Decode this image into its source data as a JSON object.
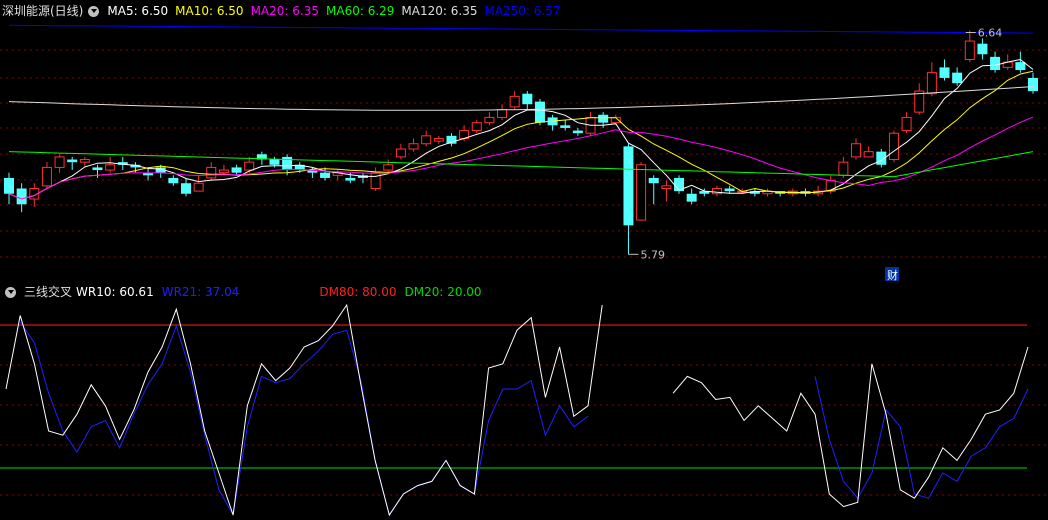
{
  "main_panel": {
    "stock_title": "深圳能源(日线)",
    "indicators": [
      {
        "label": "MA5: 6.50",
        "color": "#ffffff"
      },
      {
        "label": "MA10: 6.50",
        "color": "#ffff00"
      },
      {
        "label": "MA20: 6.35",
        "color": "#ff00ff"
      },
      {
        "label": "MA60: 6.29",
        "color": "#00ff00"
      },
      {
        "label": "MA120: 6.35",
        "color": "#dddddd"
      },
      {
        "label": "MA250: 6.57",
        "color": "#0000ff"
      }
    ],
    "high_label": "6.64",
    "low_label": "5.79",
    "finance_badge": "财"
  },
  "sub_panel": {
    "indicator_name": "三线交叉",
    "wr10_label": "WR10: 60.61",
    "wr21_label": "WR21: 37.04",
    "dm80_label": "DM80: 80.00",
    "dm20_label": "DM20: 20.00"
  },
  "colors": {
    "up": "#ff3030",
    "down": "#54ffff",
    "grid": "#8b0000",
    "border": "#b00000",
    "wr10": "#ffffff",
    "wr21": "#2020ff",
    "dm80": "#ff2020",
    "dm20": "#00dd00"
  },
  "chart_data": {
    "type": "candlestick",
    "price_range": [
      5.7,
      6.68
    ],
    "candles": [
      [
        6.08,
        6.02,
        6.1,
        5.98
      ],
      [
        6.04,
        5.98,
        6.06,
        5.95
      ],
      [
        6.0,
        6.04,
        6.06,
        5.97
      ],
      [
        6.05,
        6.12,
        6.14,
        6.04
      ],
      [
        6.12,
        6.16,
        6.17,
        6.1
      ],
      [
        6.15,
        6.14,
        6.16,
        6.11
      ],
      [
        6.14,
        6.15,
        6.16,
        6.12
      ],
      [
        6.12,
        6.11,
        6.13,
        6.08
      ],
      [
        6.11,
        6.13,
        6.16,
        6.1
      ],
      [
        6.14,
        6.13,
        6.16,
        6.11
      ],
      [
        6.13,
        6.12,
        6.14,
        6.1
      ],
      [
        6.1,
        6.09,
        6.12,
        6.07
      ],
      [
        6.12,
        6.1,
        6.13,
        6.08
      ],
      [
        6.08,
        6.06,
        6.09,
        6.05
      ],
      [
        6.06,
        6.02,
        6.08,
        6.01
      ],
      [
        6.03,
        6.06,
        6.09,
        6.03
      ],
      [
        6.08,
        6.12,
        6.14,
        6.07
      ],
      [
        6.1,
        6.11,
        6.13,
        6.09
      ],
      [
        6.12,
        6.1,
        6.13,
        6.09
      ],
      [
        6.11,
        6.14,
        6.16,
        6.1
      ],
      [
        6.17,
        6.15,
        6.18,
        6.13
      ],
      [
        6.15,
        6.13,
        6.16,
        6.12
      ],
      [
        6.16,
        6.11,
        6.17,
        6.09
      ],
      [
        6.13,
        6.11,
        6.14,
        6.1
      ],
      [
        6.11,
        6.1,
        6.12,
        6.08
      ],
      [
        6.1,
        6.08,
        6.12,
        6.07
      ],
      [
        6.09,
        6.1,
        6.11,
        6.07
      ],
      [
        6.08,
        6.07,
        6.1,
        6.06
      ],
      [
        6.09,
        6.08,
        6.1,
        6.06
      ],
      [
        6.04,
        6.1,
        6.12,
        6.03
      ],
      [
        6.11,
        6.13,
        6.15,
        6.1
      ],
      [
        6.16,
        6.19,
        6.21,
        6.15
      ],
      [
        6.19,
        6.21,
        6.23,
        6.18
      ],
      [
        6.21,
        6.24,
        6.26,
        6.2
      ],
      [
        6.22,
        6.23,
        6.24,
        6.21
      ],
      [
        6.24,
        6.21,
        6.25,
        6.2
      ],
      [
        6.23,
        6.26,
        6.28,
        6.22
      ],
      [
        6.26,
        6.29,
        6.3,
        6.25
      ],
      [
        6.29,
        6.31,
        6.33,
        6.28
      ],
      [
        6.31,
        6.34,
        6.36,
        6.3
      ],
      [
        6.35,
        6.39,
        6.41,
        6.34
      ],
      [
        6.4,
        6.36,
        6.41,
        6.34
      ],
      [
        6.37,
        6.29,
        6.38,
        6.28
      ],
      [
        6.31,
        6.28,
        6.32,
        6.26
      ],
      [
        6.28,
        6.27,
        6.3,
        6.26
      ],
      [
        6.26,
        6.25,
        6.27,
        6.24
      ],
      [
        6.25,
        6.31,
        6.33,
        6.24
      ],
      [
        6.32,
        6.29,
        6.33,
        6.27
      ],
      [
        6.29,
        6.31,
        6.32,
        6.28
      ],
      [
        6.2,
        5.9,
        6.21,
        5.79
      ],
      [
        5.92,
        6.13,
        6.14,
        5.92
      ],
      [
        6.08,
        6.06,
        6.09,
        5.98
      ],
      [
        6.04,
        6.05,
        6.07,
        5.99
      ],
      [
        6.08,
        6.03,
        6.09,
        6.02
      ],
      [
        6.02,
        5.99,
        6.04,
        5.98
      ],
      [
        6.03,
        6.02,
        6.04,
        6.01
      ],
      [
        6.02,
        6.04,
        6.05,
        6.01
      ],
      [
        6.04,
        6.03,
        6.05,
        6.02
      ],
      [
        6.03,
        6.03,
        6.04,
        6.02
      ],
      [
        6.03,
        6.02,
        6.04,
        6.01
      ],
      [
        6.02,
        6.03,
        6.04,
        6.01
      ],
      [
        6.03,
        6.02,
        6.03,
        6.01
      ],
      [
        6.02,
        6.03,
        6.04,
        6.01
      ],
      [
        6.03,
        6.02,
        6.04,
        6.01
      ],
      [
        6.02,
        6.03,
        6.05,
        6.01
      ],
      [
        6.03,
        6.07,
        6.09,
        6.02
      ],
      [
        6.09,
        6.14,
        6.16,
        6.08
      ],
      [
        6.16,
        6.21,
        6.23,
        6.15
      ],
      [
        6.16,
        6.18,
        6.2,
        6.16
      ],
      [
        6.18,
        6.13,
        6.19,
        6.12
      ],
      [
        6.15,
        6.25,
        6.26,
        6.14
      ],
      [
        6.26,
        6.31,
        6.33,
        6.25
      ],
      [
        6.33,
        6.41,
        6.44,
        6.32
      ],
      [
        6.4,
        6.48,
        6.52,
        6.39
      ],
      [
        6.5,
        6.46,
        6.53,
        6.45
      ],
      [
        6.48,
        6.44,
        6.5,
        6.43
      ],
      [
        6.53,
        6.6,
        6.64,
        6.52
      ],
      [
        6.59,
        6.55,
        6.61,
        6.53
      ],
      [
        6.54,
        6.49,
        6.56,
        6.48
      ],
      [
        6.5,
        6.52,
        6.55,
        6.49
      ],
      [
        6.52,
        6.49,
        6.56,
        6.48
      ],
      [
        6.46,
        6.41,
        6.48,
        6.4
      ]
    ],
    "wr10": [
      60,
      95,
      72,
      40,
      38,
      48,
      62,
      52,
      36,
      50,
      68,
      80,
      98,
      72,
      40,
      20,
      0,
      52,
      72,
      64,
      70,
      80,
      83,
      90,
      100,
      62,
      26,
      0,
      10,
      14,
      16,
      26,
      14,
      10,
      70,
      72,
      88,
      94,
      56,
      80,
      47,
      52,
      100,
      null,
      null,
      null,
      null,
      58,
      66,
      63,
      55,
      56,
      45,
      52,
      46,
      40,
      58,
      48,
      10,
      4,
      6,
      72,
      48,
      12,
      8,
      18,
      32,
      26,
      36,
      48,
      50,
      58,
      80
    ],
    "wr21": [
      null,
      92,
      82,
      58,
      40,
      30,
      42,
      45,
      32,
      48,
      62,
      72,
      90,
      68,
      38,
      12,
      0,
      42,
      66,
      63,
      65,
      72,
      78,
      86,
      88,
      64,
      26,
      0,
      10,
      14,
      16,
      26,
      14,
      10,
      45,
      60,
      60,
      64,
      38,
      52,
      42,
      47,
      null,
      null,
      null,
      null,
      null,
      null,
      null,
      null,
      null,
      null,
      null,
      null,
      null,
      null,
      null,
      66,
      36,
      16,
      8,
      20,
      50,
      42,
      10,
      8,
      20,
      16,
      28,
      32,
      42,
      46,
      60
    ],
    "dm80": 80,
    "dm20": 20
  }
}
